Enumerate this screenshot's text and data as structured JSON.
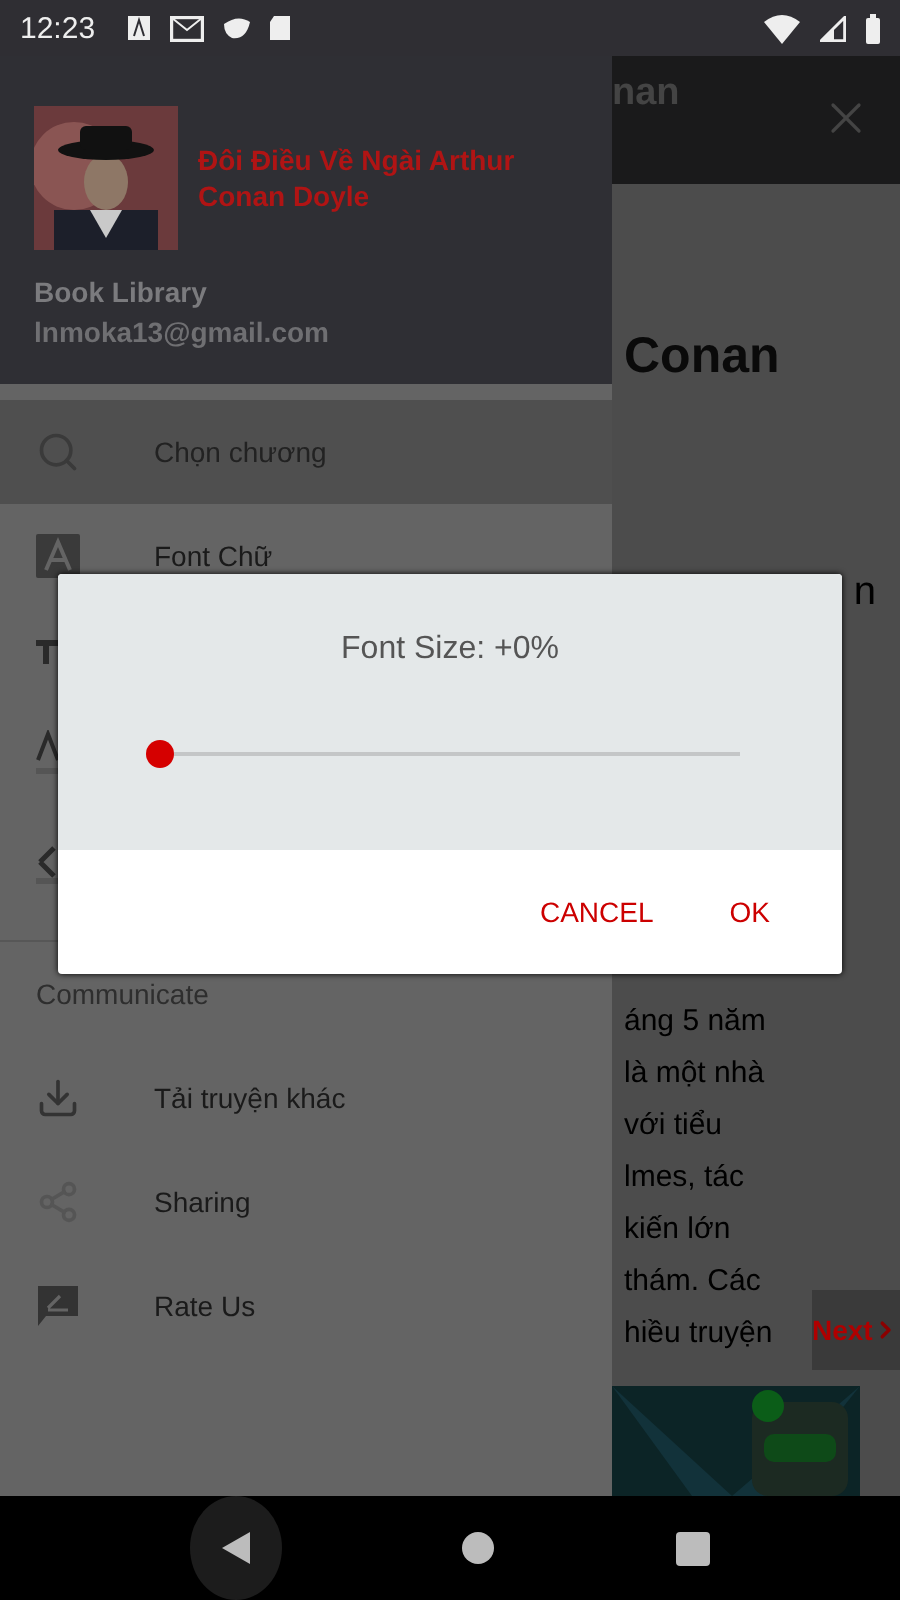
{
  "status_bar": {
    "time": "12:23"
  },
  "drawer": {
    "header": {
      "book_title": "Đôi Điều Về Ngài Arthur Conan Doyle",
      "app_name": "Book Library",
      "email": "lnmoka13@gmail.com"
    },
    "items": [
      {
        "label": "Chọn chương",
        "selected": true
      },
      {
        "label": "Font Chữ",
        "selected": false
      }
    ],
    "section": "Communicate",
    "communicate_items": [
      {
        "label": "Tải truyện khác"
      },
      {
        "label": "Sharing"
      },
      {
        "label": "Rate Us"
      }
    ]
  },
  "reader": {
    "title": "nan",
    "heading": "Conan",
    "fragment": "n",
    "lines": [
      "áng 5 năm",
      "là một nhà",
      "với tiểu",
      "lmes, tác",
      "kiến lớn",
      "thám. Các",
      "hiều truyện"
    ],
    "next_button": "Next"
  },
  "dialog": {
    "title": "Font Size: +0%",
    "slider": {
      "level": 0
    },
    "buttons": [
      "CANCEL",
      "OK"
    ]
  }
}
